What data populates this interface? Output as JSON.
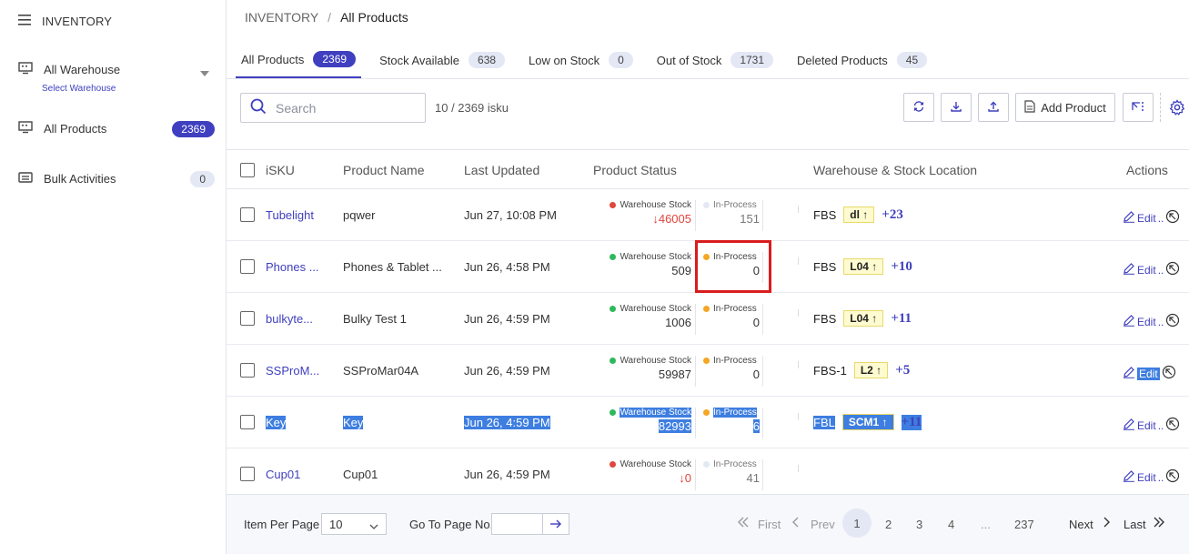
{
  "sidebar": {
    "title": "INVENTORY",
    "warehouse": {
      "label": "All Warehouse",
      "sub": "Select Warehouse"
    },
    "items": [
      {
        "label": "All Products",
        "badge": "2369"
      },
      {
        "label": "Bulk Activities",
        "badge": "0"
      }
    ]
  },
  "breadcrumb": {
    "parent": "INVENTORY",
    "separator": "/",
    "current": "All Products"
  },
  "tabs": [
    {
      "label": "All Products",
      "count": "2369"
    },
    {
      "label": "Stock Available",
      "count": "638"
    },
    {
      "label": "Low on Stock",
      "count": "0"
    },
    {
      "label": "Out of Stock",
      "count": "1731"
    },
    {
      "label": "Deleted Products",
      "count": "45"
    }
  ],
  "toolbar": {
    "search_placeholder": "Search",
    "count": "10 / 2369 isku",
    "add_label": "Add Product"
  },
  "table": {
    "headers": [
      "iSKU",
      "Product Name",
      "Last Updated",
      "Product Status",
      "Warehouse & Stock Location",
      "Actions"
    ],
    "ws_label": "Warehouse Stock",
    "ip_label": "In-Process",
    "edit_label": "Edit",
    "ellipsis": "..",
    "rows": [
      {
        "sku": "Tubelight",
        "name": "pqwer",
        "updated": "Jun 27, 10:08 PM",
        "ws": "46005",
        "ws_arrow": "↓",
        "ip": "151",
        "wh": "FBS",
        "loc": "dl ↑",
        "more": "+23"
      },
      {
        "sku": "Phones ...",
        "name": "Phones & Tablet ...",
        "updated": "Jun 26, 4:58 PM",
        "ws": "509",
        "ip": "0",
        "wh": "FBS",
        "loc": "L04 ↑",
        "more": "+10"
      },
      {
        "sku": "bulkyte...",
        "name": "Bulky Test 1",
        "updated": "Jun 26, 4:59 PM",
        "ws": "1006",
        "ip": "0",
        "wh": "FBS",
        "loc": "L04 ↑",
        "more": "+11"
      },
      {
        "sku": "SSProM...",
        "name": "SSProMar04A",
        "updated": "Jun 26, 4:59 PM",
        "ws": "59987",
        "ip": "0",
        "wh": "FBS-1",
        "loc": "L2 ↑",
        "more": "+5"
      },
      {
        "sku": "Key",
        "name": "Key",
        "updated": "Jun 26, 4:59 PM",
        "ws": "82993",
        "ip": "6",
        "wh": "FBL",
        "loc": "SCM1 ↑",
        "more": "+11"
      },
      {
        "sku": "Cup01",
        "name": "Cup01",
        "updated": "Jun 26, 4:59 PM",
        "ws": "0",
        "ws_arrow": "↓",
        "ip": "41",
        "wh": "",
        "loc": "",
        "more": ""
      }
    ]
  },
  "footer": {
    "per_page_label": "Item Per Page",
    "per_page": "10",
    "goto_label": "Go To Page No.",
    "first": "First",
    "prev": "Prev",
    "pages": [
      "1",
      "2",
      "3",
      "4",
      "...",
      "237"
    ],
    "next": "Next",
    "last": "Last"
  },
  "colors": {
    "accent": "#3f3fbf",
    "selection": "#3d7ee0",
    "highlight_box": "#d91c1c",
    "green_dot": "#2eb85c",
    "orange_dot": "#f5a623",
    "red_dot": "#e0453e"
  }
}
